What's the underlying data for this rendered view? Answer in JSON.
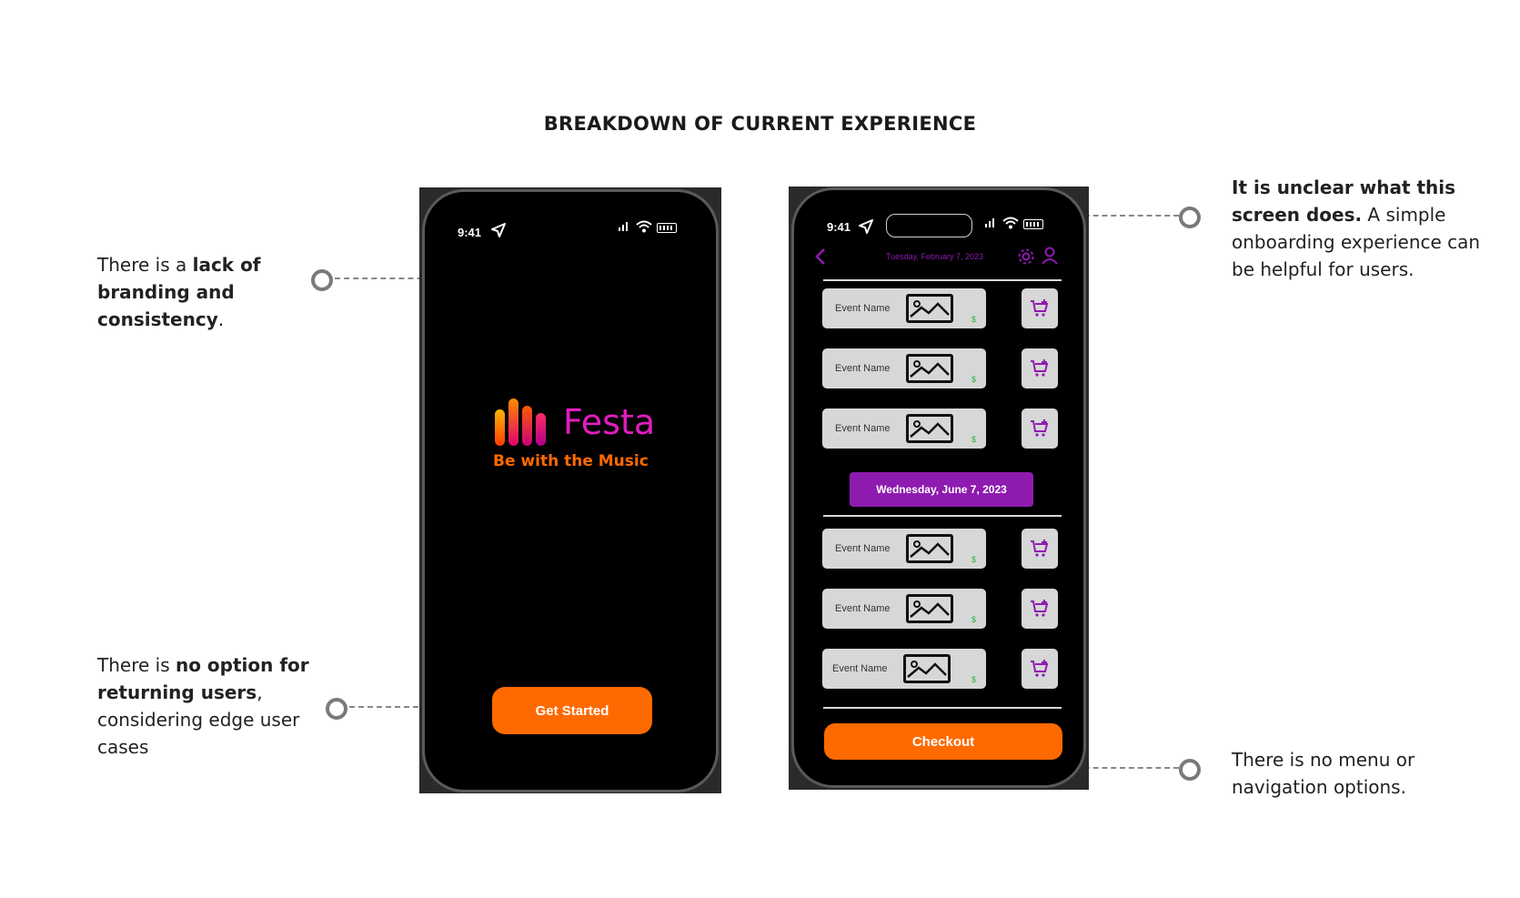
{
  "title": "BREAKDOWN OF CURRENT EXPERIENCE",
  "notes": {
    "branding": {
      "pre": "There is a ",
      "bold": "lack of branding and consistency",
      "post": "."
    },
    "returning": {
      "pre": "There is ",
      "bold": "no option for returning users",
      "post": ", considering edge user cases"
    },
    "unclear": {
      "bold": "It is unclear what this screen does.",
      "post": " A simple onboarding experience can be helpful for users."
    },
    "nav": {
      "text": "There is no menu or navigation options."
    }
  },
  "phone1": {
    "time": "9:41",
    "brand": "Festa",
    "tagline": "Be with the Music",
    "cta": "Get Started"
  },
  "phone2": {
    "time": "9:41",
    "header_date": "Tuesday, February 7, 2023",
    "section_date": "Wednesday, June 7, 2023",
    "event_label": "Event Name",
    "price": "$",
    "checkout": "Checkout"
  },
  "colors": {
    "brand_magenta": "#e11dbf",
    "accent_orange": "#ff6a00",
    "purple": "#8e1bb0",
    "price_green": "#2bb34a"
  }
}
